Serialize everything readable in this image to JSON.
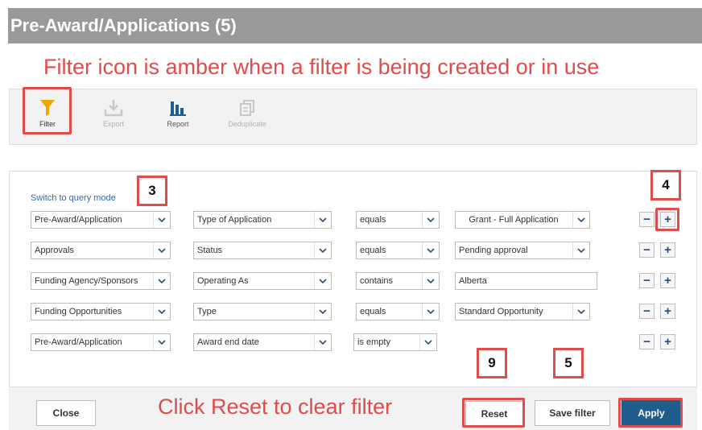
{
  "window": {
    "title": "Pre-Award/Applications (5)"
  },
  "annotations": {
    "top_note": "Filter icon is amber when a filter is being created or in use",
    "bottom_note": "Click Reset to clear filter",
    "badge_3": "3",
    "badge_4": "4",
    "badge_9": "9",
    "badge_5": "5",
    "highlight_color": "#e04b4b"
  },
  "toolbar": {
    "filter": {
      "label": "Filter",
      "icon": "filter-icon",
      "color": "#f0a500"
    },
    "export": {
      "label": "Export",
      "icon": "export-icon"
    },
    "report": {
      "label": "Report",
      "icon": "report-icon",
      "color": "#1f5d8c"
    },
    "deduplicate": {
      "label": "Deduplicate",
      "icon": "deduplicate-icon"
    }
  },
  "filter_panel": {
    "query_link": "Switch to query mode",
    "rows": [
      {
        "entity": "Pre-Award/Application",
        "field": "Type of Application",
        "operator": "equals",
        "value": "Grant - Full Application",
        "value_kind": "select"
      },
      {
        "entity": "Approvals",
        "field": "Status",
        "operator": "equals",
        "value": "Pending approval",
        "value_kind": "select"
      },
      {
        "entity": "Funding Agency/Sponsors",
        "field": "Operating As",
        "operator": "contains",
        "value": "Alberta",
        "value_kind": "text"
      },
      {
        "entity": "Funding Opportunities",
        "field": "Type",
        "operator": "equals",
        "value": "Standard Opportunity",
        "value_kind": "select"
      },
      {
        "entity": "Pre-Award/Application",
        "field": "Award end date",
        "operator": "is empty",
        "value": "",
        "value_kind": "none"
      }
    ],
    "minus_symbol": "−",
    "plus_symbol": "+"
  },
  "footer": {
    "close_label": "Close",
    "reset_label": "Reset",
    "save_filter_label": "Save filter",
    "apply_label": "Apply",
    "apply_color": "#1f5d8c"
  }
}
